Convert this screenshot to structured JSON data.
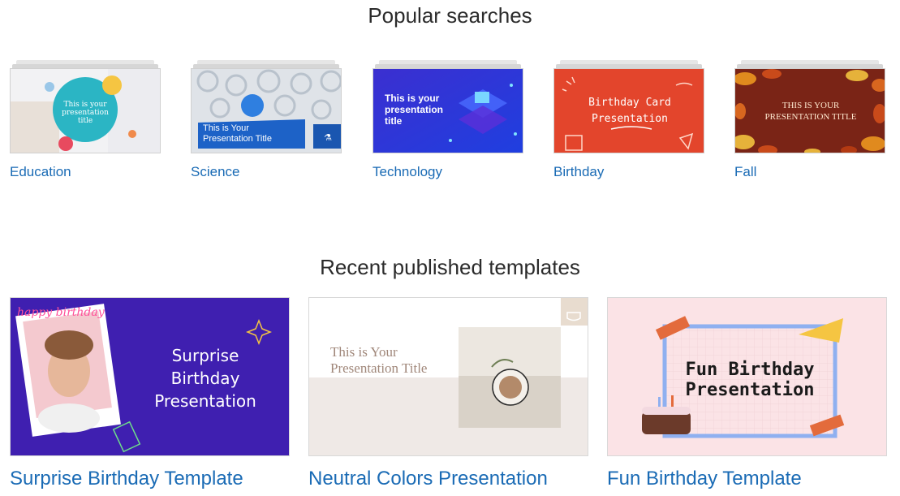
{
  "popular": {
    "title": "Popular searches",
    "items": [
      {
        "label": "Education",
        "thumb_text": "This is your presentation title"
      },
      {
        "label": "Science",
        "thumb_text_1": "This is Your",
        "thumb_text_2": "Presentation Title"
      },
      {
        "label": "Technology",
        "thumb_text_1": "This is your",
        "thumb_text_2": "presentation",
        "thumb_text_3": "title"
      },
      {
        "label": "Birthday",
        "thumb_text_1": "Birthday Card",
        "thumb_text_2": "Presentation"
      },
      {
        "label": "Fall",
        "thumb_text_1": "THIS IS YOUR",
        "thumb_text_2": "PRESENTATION TITLE"
      }
    ]
  },
  "recent": {
    "title": "Recent published templates",
    "items": [
      {
        "label": "Surprise Birthday Template",
        "thumb_text_1": "Surprise",
        "thumb_text_2": "Birthday",
        "thumb_text_3": "Presentation",
        "sticker": "happy birthday"
      },
      {
        "label": "Neutral Colors Presentation",
        "thumb_text_1": "This is Your",
        "thumb_text_2": "Presentation Title"
      },
      {
        "label": "Fun Birthday Template",
        "thumb_text_1": "Fun Birthday",
        "thumb_text_2": "Presentation"
      }
    ]
  },
  "colors": {
    "link": "#1a6bb5",
    "education": "#2bb5c4",
    "science": "#1f6fd0",
    "technology": "#2a3ad8",
    "birthday": "#e3452c",
    "fall": "#7a2416",
    "surprise": "#3f1fb0",
    "neutral": "#efe9e6",
    "fun": "#fbe3e6"
  }
}
